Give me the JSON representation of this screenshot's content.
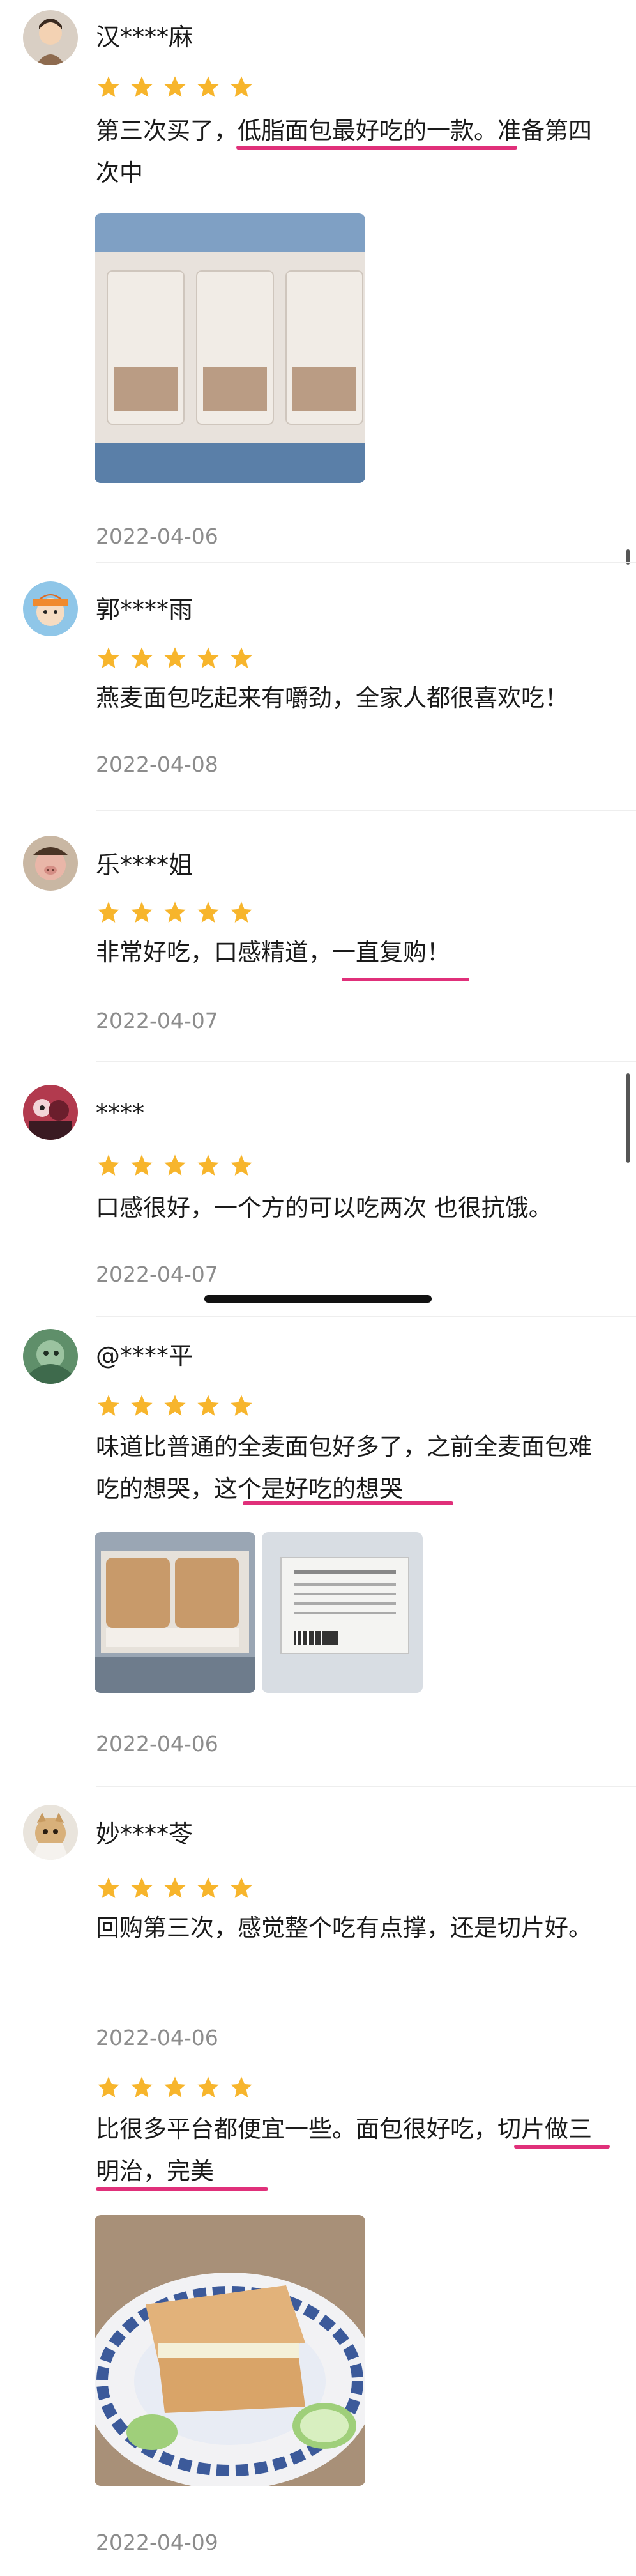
{
  "reviews": [
    {
      "user": "汉****麻",
      "text_parts": [
        "第三次买了，",
        "低脂面包最好吃的一款",
        "。准备第四次中"
      ],
      "date": "2022-04-06",
      "photos": [
        "bread-package-photo"
      ]
    },
    {
      "user": "郭****雨",
      "text_parts": [
        "燕麦面包吃起来有嚼劲，全家人都很喜欢吃！"
      ],
      "date": "2022-04-08"
    },
    {
      "user": "乐****姐",
      "text_parts": [
        "非常好吃，口感精道，",
        "一直复购",
        "！"
      ],
      "date": "2022-04-07"
    },
    {
      "user": "****",
      "text_parts": [
        "口感很好，一个方的可以吃两次 也很抗饿。"
      ],
      "date": "2022-04-07"
    },
    {
      "user": "@****平",
      "text_parts": [
        "味道比普通的全麦面包好多了，之前全麦面包难吃的想哭，",
        "这个是好吃的想哭"
      ],
      "date": "2022-04-06",
      "photos": [
        "bread-box-photo",
        "nutrition-label-photo"
      ]
    },
    {
      "user": "妙****苓",
      "text_parts": [
        "回购第三次，感觉整个吃有点撑，还是切片好。"
      ],
      "date": "2022-04-06",
      "followup": {
        "text_parts": [
          "比很多平台都便宜一些。面包很好吃，",
          "切片做三明治，完美"
        ],
        "date": "2022-04-09",
        "photos": [
          "sandwich-photo"
        ]
      }
    }
  ],
  "rating": 5,
  "colors": {
    "star": "#f7b52c",
    "highlight": "#e0307a",
    "date": "#8c8c8c"
  }
}
